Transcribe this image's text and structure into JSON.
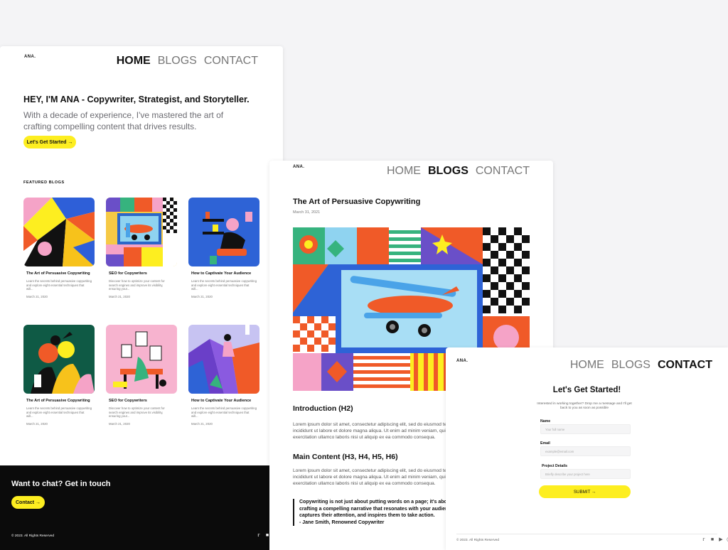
{
  "site": {
    "logo": "ANA."
  },
  "home": {
    "nav": [
      "HOME",
      "BLOGS",
      "CONTACT"
    ],
    "hero_title": "HEY, I'M ANA - Copywriter, Strategist, and Storyteller.",
    "hero_subtitle": "With a decade of experience, I've mastered the art of crafting compelling content that drives results.",
    "cta": "Let's Get Started →",
    "featured_label": "FEATURED BLOGS",
    "cards": [
      {
        "title": "The Art of Persuasive Copywriting",
        "desc": "Learn the secrets behind persuasive copywriting and explore eight essential techniques that will...",
        "date": "March 21, 2020"
      },
      {
        "title": "SEO for Copywriters",
        "desc": "Discover how to optimize your content for search engines and improve its visibility, ensuring your...",
        "date": "March 21, 2020"
      },
      {
        "title": "How to Captivate Your Audience",
        "desc": "Learn the secrets behind persuasive copywriting and explore eight essential techniques that will...",
        "date": "March 21, 2020"
      },
      {
        "title": "The Art of Persuasive Copywriting",
        "desc": "Learn the secrets behind persuasive copywriting and explore eight essential techniques that will...",
        "date": "March 21, 2020"
      },
      {
        "title": "SEO for Copywriters",
        "desc": "Discover how to optimize your content for search engines and improve its visibility, ensuring your...",
        "date": "March 21, 2020"
      },
      {
        "title": "How to Captivate Your Audience",
        "desc": "Learn the secrets behind persuasive copywriting and explore eight essential techniques that will...",
        "date": "March 21, 2020"
      }
    ],
    "footer_title": "Want to chat? Get in touch",
    "footer_cta": "Contact →",
    "copyright": "© 2023. All Rights Reserved"
  },
  "blog": {
    "nav": [
      "HOME",
      "BLOGS",
      "CONTACT"
    ],
    "title": "The Art of Persuasive Copywriting",
    "date": "March 31, 2021",
    "h2_intro": "Introduction (H2)",
    "para1": "Lorem ipsum dolor sit amet, consectetur adipiscing elit, sed do eiusmod tempor incididunt ut labore et dolore magna aliqua. Ut enim ad minim veniam, quis nostrud exercitation ullamco laboris nisi ut aliquip ex ea commodo consequa.",
    "h2_main": "Main Content (H3, H4, H5, H6)",
    "para2": "Lorem ipsum dolor sit amet, consectetur adipiscing elit, sed do eiusmod tempor incididunt ut labore et dolore magna aliqua. Ut enim ad minim veniam, quis nostrud exercitation ullamco laboris nisi ut aliquip ex ea commodo consequa.",
    "quote": "Copywriting is not just about putting words on a page; it's about crafting a compelling narrative that resonates with your audience, captures their attention, and inspires them to take action.",
    "quote_author": "- Jane Smith, Renowned Copywriter"
  },
  "contact": {
    "nav": [
      "HOME",
      "BLOGS",
      "CONTACT"
    ],
    "title": "Let's Get Started!",
    "subtitle": "Interested in working together? Drop me a message and I'll get back to you as soon as possible",
    "name_label": "Name",
    "name_placeholder": "Your full name",
    "email_label": "Email",
    "email_placeholder": "example@email.com",
    "details_label": "Project Details",
    "details_placeholder": "Briefly describe your project here",
    "submit": "SUBMIT →",
    "copyright": "© 2023. All Rights Reserved"
  },
  "social_icons": [
    "twitter-icon",
    "linkedin-icon",
    "youtube-icon",
    "instagram-icon"
  ],
  "colors": {
    "accent": "#fdee20",
    "footer_bg": "#0b0b0b"
  }
}
